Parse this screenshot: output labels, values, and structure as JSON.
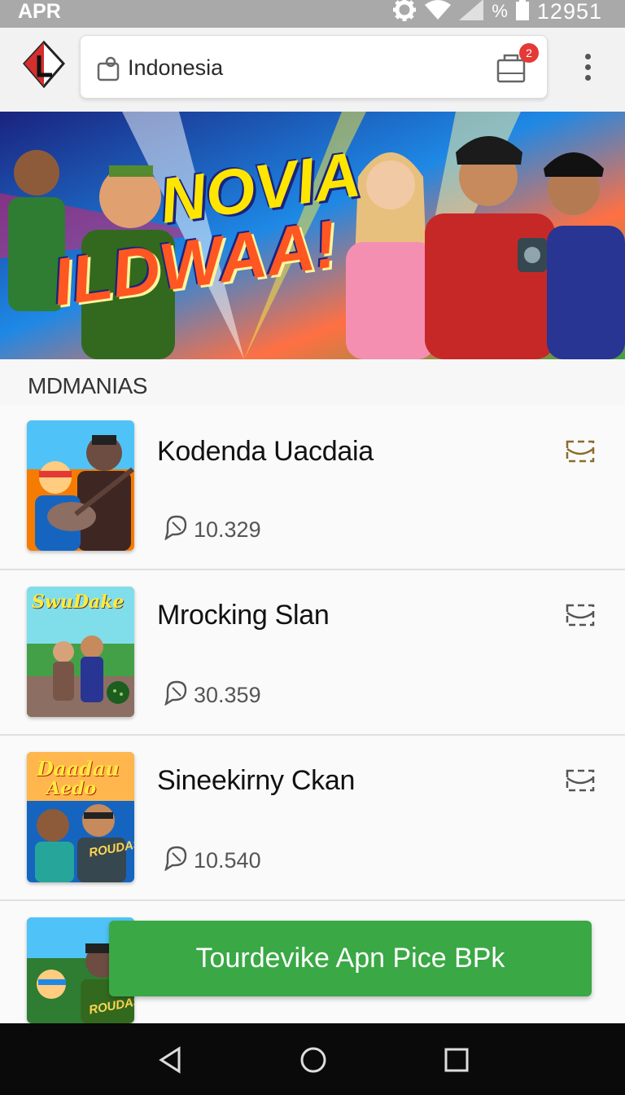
{
  "status_bar": {
    "left_text": "APR",
    "percent_symbol": "%",
    "clock": "12951",
    "icons": [
      "gear-icon",
      "wifi-icon",
      "signal-icon",
      "battery-icon"
    ]
  },
  "app_bar": {
    "search_location": "Indonesia",
    "cart_badge": "2",
    "icons": [
      "app-logo-icon",
      "location-icon",
      "cart-icon",
      "more-vert-icon"
    ]
  },
  "banner": {
    "line1": "NOVIA",
    "line2": "ILDWAA!"
  },
  "section": {
    "title": "MDMANIAS"
  },
  "items": [
    {
      "title": "Kodenda Uacdaia",
      "stat": "10.329"
    },
    {
      "title": "Mrocking Slan",
      "stat": "30.359"
    },
    {
      "title": "Sineekirny Ckan",
      "stat": "10.540"
    }
  ],
  "thumb_texts": {
    "item2": "SwuDake",
    "item3_top": "Daadau",
    "item3_mid": "Aedo",
    "item3_badge": "ROUDAS",
    "item4_badge": "ROUDAS"
  },
  "cta": {
    "label": "Tourdevike  Apn Pice BPk"
  },
  "colors": {
    "status_bar": "#a9a9a9",
    "cta_green": "#3aa845",
    "badge_red": "#e53935",
    "nav_bar": "#0a0a0a"
  }
}
